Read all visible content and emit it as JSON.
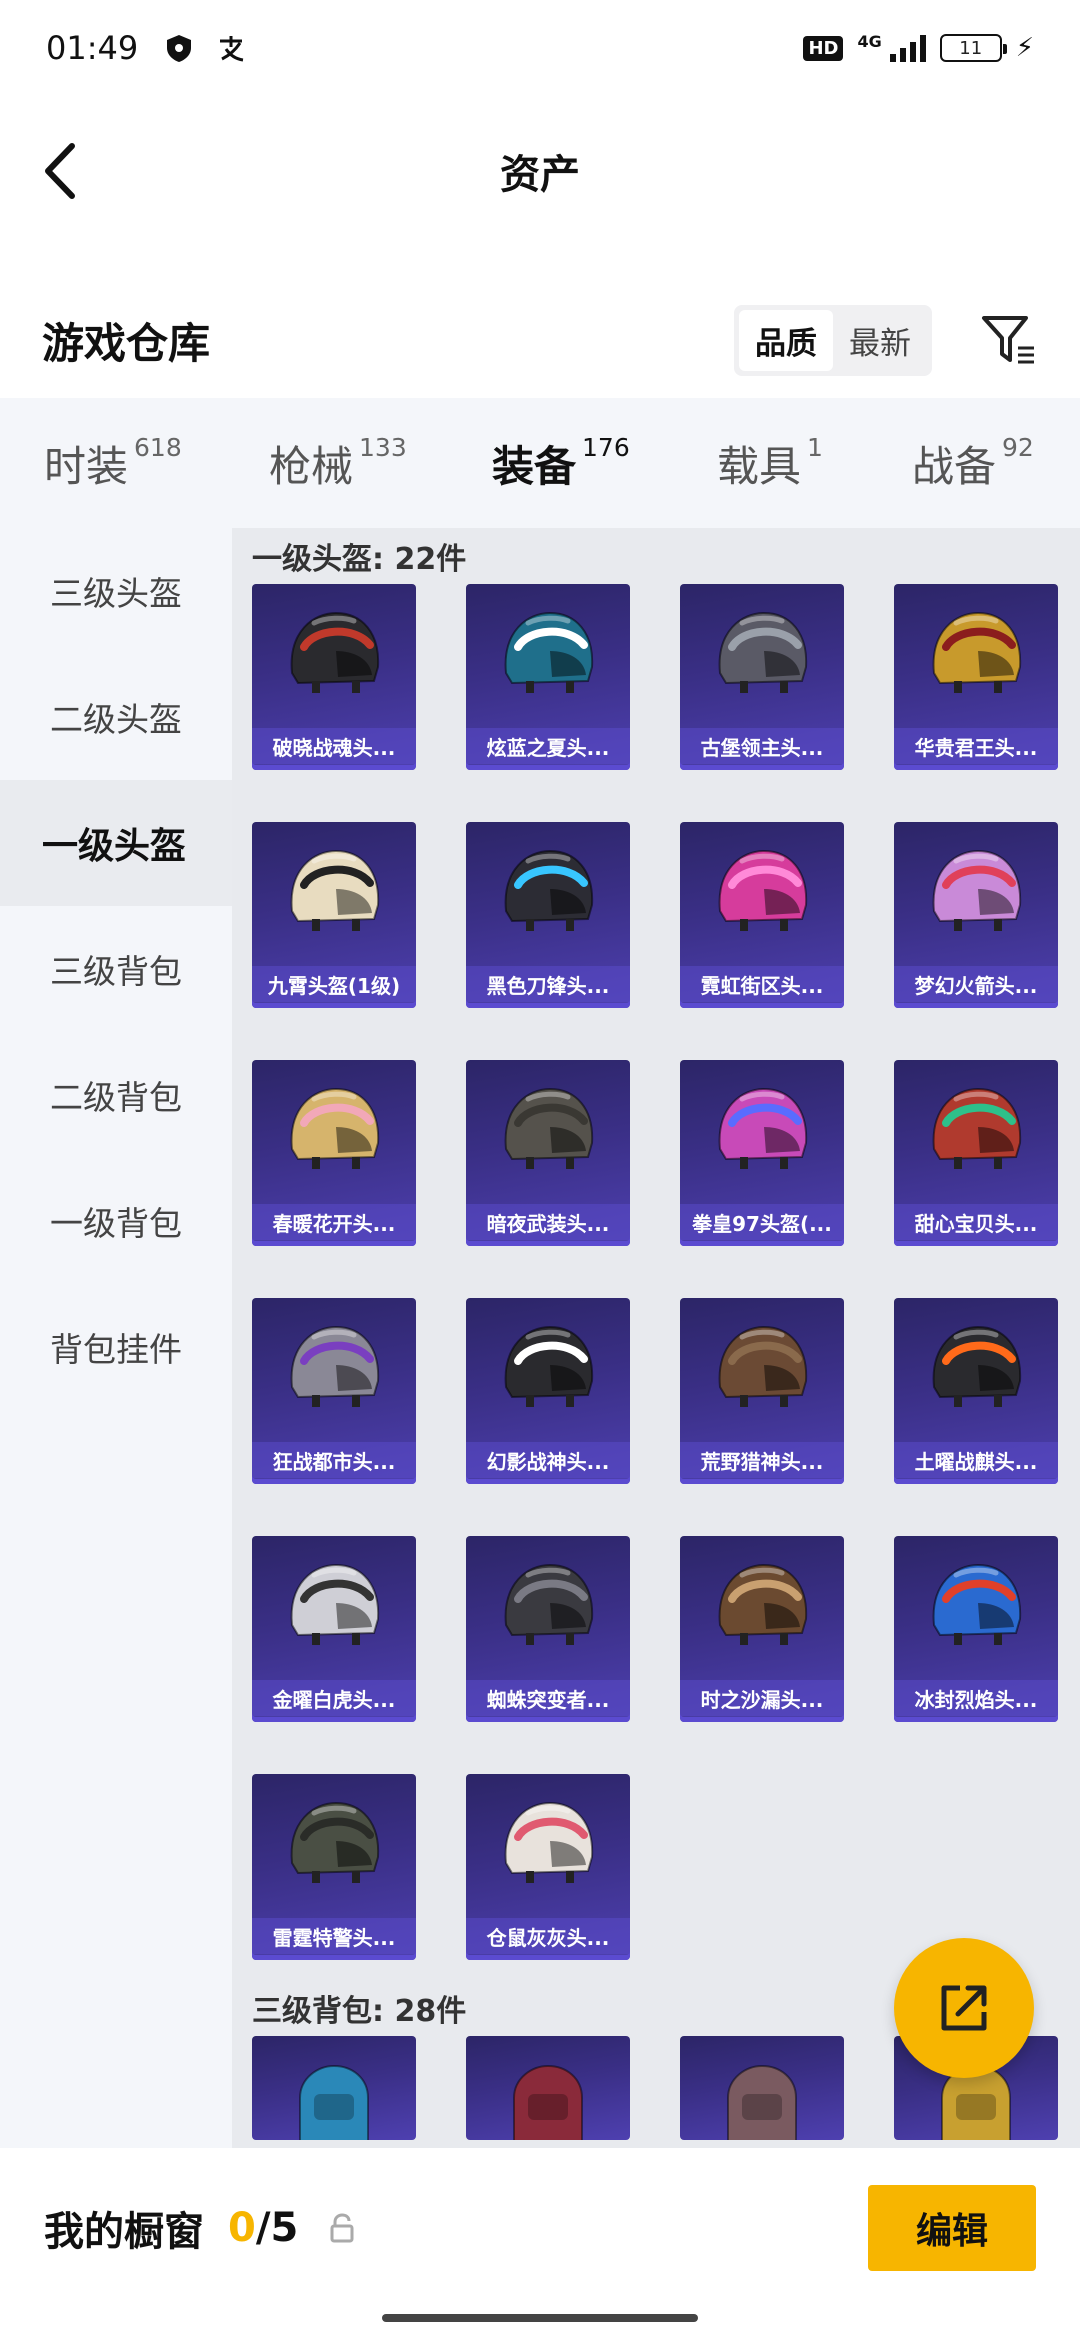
{
  "status_bar": {
    "time": "01:49",
    "hd": "HD",
    "network": "4G",
    "battery": "11"
  },
  "header": {
    "title": "资产"
  },
  "warehouse": {
    "title": "游戏仓库",
    "sort_options": [
      "品质",
      "最新"
    ],
    "active_sort": "品质"
  },
  "category_tabs": [
    {
      "label": "时装",
      "count": "618"
    },
    {
      "label": "枪械",
      "count": "133"
    },
    {
      "label": "装备",
      "count": "176",
      "active": true
    },
    {
      "label": "载具",
      "count": "1"
    },
    {
      "label": "战备",
      "count": "92"
    }
  ],
  "sidebar": {
    "items": [
      "三级头盔",
      "二级头盔",
      "一级头盔",
      "三级背包",
      "二级背包",
      "一级背包",
      "背包挂件"
    ],
    "active": "一级头盔"
  },
  "sections": [
    {
      "title": "一级头盔: 22件",
      "items": [
        {
          "name": "破晓战魂头...",
          "color": "#2a2a2e",
          "accent": "#c0392b"
        },
        {
          "name": "炫蓝之夏头...",
          "color": "#1f6f8b",
          "accent": "#ffffff"
        },
        {
          "name": "古堡领主头...",
          "color": "#5a5a66",
          "accent": "#9aa0aa"
        },
        {
          "name": "华贵君王头...",
          "color": "#c89a2c",
          "accent": "#8b1d1d"
        },
        {
          "name": "九霄头盔(1级)",
          "color": "#e8dcc0",
          "accent": "#222222"
        },
        {
          "name": "黑色刀锋头...",
          "color": "#2c2c34",
          "accent": "#38c6ff"
        },
        {
          "name": "霓虹街区头...",
          "color": "#d63c9c",
          "accent": "#ff8ad8"
        },
        {
          "name": "梦幻火箭头...",
          "color": "#c98ad8",
          "accent": "#e0405a"
        },
        {
          "name": "春暖花开头...",
          "color": "#d6b46c",
          "accent": "#f2a8b8"
        },
        {
          "name": "暗夜武装头...",
          "color": "#55524c",
          "accent": "#3a3833"
        },
        {
          "name": "拳皇97头盔(...",
          "color": "#c84ab8",
          "accent": "#5a6cff"
        },
        {
          "name": "甜心宝贝头...",
          "color": "#b03a2e",
          "accent": "#2ec08a"
        },
        {
          "name": "狂战都市头...",
          "color": "#8a8896",
          "accent": "#7a3fc0"
        },
        {
          "name": "幻影战神头...",
          "color": "#2a2a2e",
          "accent": "#ffffff"
        },
        {
          "name": "荒野猎神头...",
          "color": "#6b4a34",
          "accent": "#8a6a4c"
        },
        {
          "name": "土曜战麒头...",
          "color": "#2a2a2e",
          "accent": "#ff6a1a"
        },
        {
          "name": "金曜白虎头...",
          "color": "#cfcfd6",
          "accent": "#333333"
        },
        {
          "name": "蜘蛛突变者...",
          "color": "#3a3a40",
          "accent": "#7a7a84"
        },
        {
          "name": "时之沙漏头...",
          "color": "#6b4a30",
          "accent": "#c9a070"
        },
        {
          "name": "冰封烈焰头...",
          "color": "#2a6ad0",
          "accent": "#e0402a"
        },
        {
          "name": "雷霆特警头...",
          "color": "#4a4f44",
          "accent": "#2a2c28"
        },
        {
          "name": "仓鼠灰灰头...",
          "color": "#e8e2dc",
          "accent": "#e05a70"
        }
      ]
    },
    {
      "title": "三级背包: 28件",
      "items": [
        {
          "color": "#2a88b8"
        },
        {
          "color": "#8a2a3a"
        },
        {
          "color": "#7a5a60"
        },
        {
          "color": "#c8a030"
        }
      ]
    }
  ],
  "bottom_bar": {
    "showcase_label": "我的橱窗",
    "showcase_current": "0",
    "showcase_sep": "/",
    "showcase_max": "5",
    "edit_label": "编辑"
  }
}
